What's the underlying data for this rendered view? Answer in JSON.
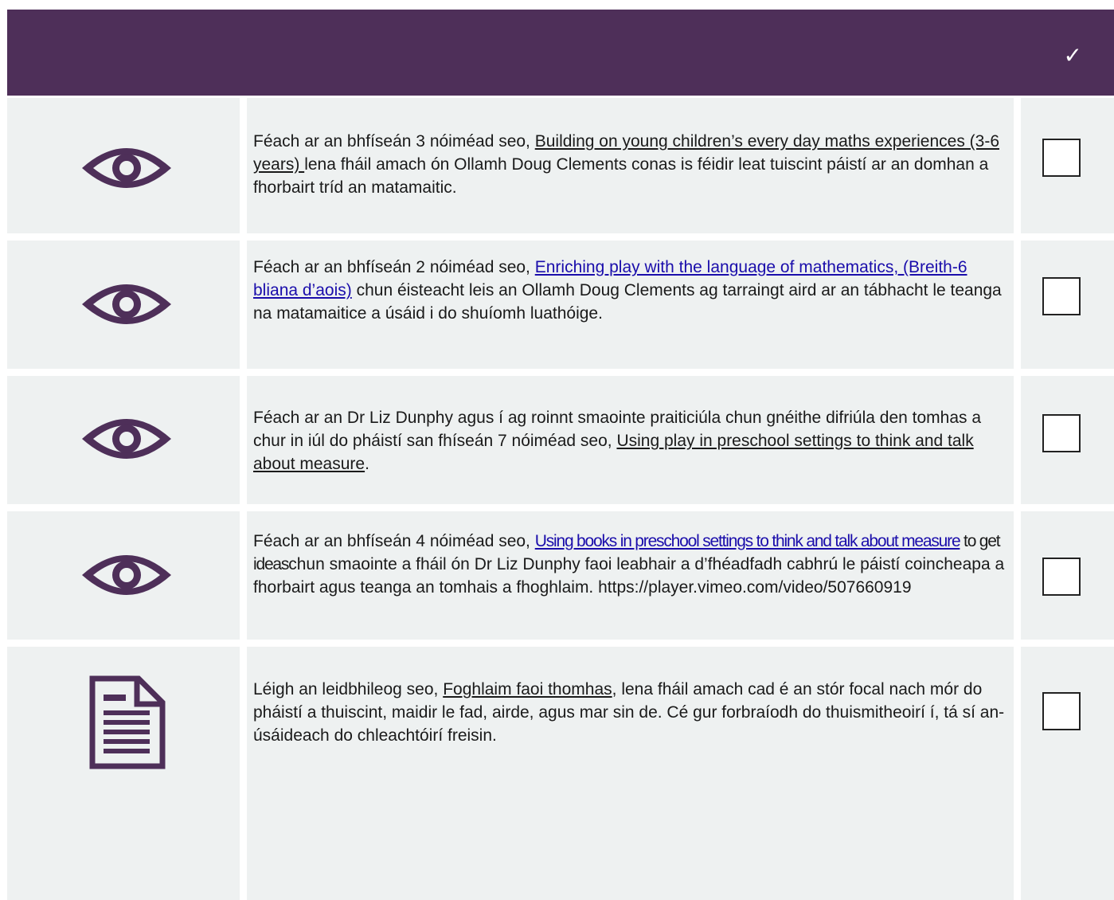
{
  "header": {
    "check_symbol": "✓"
  },
  "colors": {
    "header_bg": "#4e2f59",
    "icon": "#4e2f59",
    "cell_bg": "#eef1f1",
    "link": "#1a0dab"
  },
  "rows": [
    {
      "icon": "eye-icon",
      "text_before": "Féach ar an bhfíseán 3 nóiméad seo, ",
      "link": "Building on young children’s every day maths experiences (3-6 years) ",
      "text_after": "lena fháil amach ón Ollamh Doug Clements conas is féidir leat tuiscint páistí ar an domhan a fhorbairt tríd an matamaitic."
    },
    {
      "icon": "eye-icon",
      "text_before": "Féach ar an bhfíseán 2 nóiméad seo, ",
      "link": "Enriching play with the language of mathematics, (Breith-6 bliana d’aois)",
      "text_after": " chun éisteacht leis an Ollamh Doug Clements ag tarraingt aird ar an tábhacht le teanga na matamaitice a úsáid i do shuíomh luathóige."
    },
    {
      "icon": "eye-icon",
      "text_before": "Féach ar an Dr Liz Dunphy agus í ag roinnt smaointe praiticiúla chun gnéithe difriúla den tomhas a chur in iúl do pháistí san fhíseán 7 nóiméad seo, ",
      "link": "Using play in preschool settings to think and talk about measure",
      "text_after": "."
    },
    {
      "icon": "eye-icon",
      "text_before": "Féach ar an bhfíseán 4 nóiméad seo, ",
      "link": "Using books in preschool settings to think and talk about measure",
      "text_mid": " to get ideas",
      "text_after": "chun smaointe a fháil ón Dr Liz Dunphy faoi leabhair a d’fhéadfadh cabhrú le páistí coincheapa a fhorbairt agus teanga an tomhais a fhoghlaim. https://player.vimeo.com/video/507660919"
    },
    {
      "icon": "document-icon",
      "text_before": "Léigh an leidbhileog seo, ",
      "link": "Foghlaim faoi thomhas",
      "text_after": ", lena fháil amach cad é an stór focal nach mór do pháistí a thuiscint, maidir le fad, airde, agus mar sin de. Cé gur forbraíodh do thuismitheoirí í, tá sí an-úsáideach do chleachtóirí freisin."
    }
  ]
}
